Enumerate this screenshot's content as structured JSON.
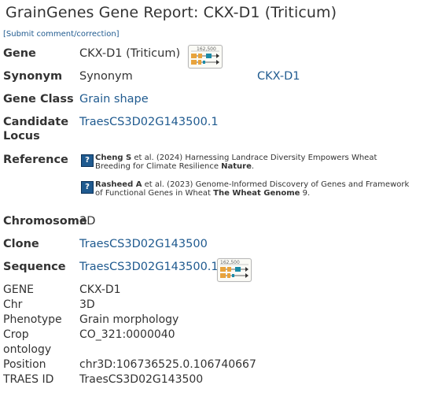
{
  "header": {
    "title": "GrainGenes Gene Report: CKX-D1 (Triticum)",
    "submit_link": "[Submit comment/correction]"
  },
  "gene": {
    "label": "Gene",
    "value": "CKX-D1 (Triticum)"
  },
  "synonym": {
    "label": "Synonym",
    "value_label": "Synonym",
    "value": "CKX-D1"
  },
  "gene_class": {
    "label": "Gene Class",
    "value": "Grain shape"
  },
  "candidate_locus": {
    "label_line1": "Candidate",
    "label_line2": "Locus",
    "value": "TraesCS3D02G143500.1"
  },
  "reference": {
    "label": "Reference",
    "items": [
      {
        "author": "Cheng S",
        "citation_mid": " et al. (2024) Harnessing Landrace Diversity Empowers Wheat Breeding for Climate Resilience ",
        "journal": "Nature",
        "tail": "."
      },
      {
        "author": "Rasheed A",
        "citation_mid": " et al. (2023) Genome-Informed Discovery of Genes and Framework of Functional Genes in Wheat ",
        "journal": "The Wheat Genome",
        "tail": " 9."
      }
    ],
    "icon": "question-icon",
    "icon_text": "?"
  },
  "chromosome": {
    "label": "Chromosome",
    "value": "3D"
  },
  "clone": {
    "label": "Clone",
    "value": "TraesCS3D02G143500"
  },
  "sequence": {
    "label": "Sequence",
    "value": "TraesCS3D02G143500.1"
  },
  "thumbnail": {
    "text": "162,500",
    "icon": "gene-model-thumbnail"
  },
  "details": [
    {
      "label": "GENE",
      "value": "CKX-D1"
    },
    {
      "label": "Chr",
      "value": "3D"
    },
    {
      "label": "Phenotype",
      "value": "Grain morphology"
    },
    {
      "label": "Crop",
      "label2": "ontology",
      "value": "CO_321:0000040"
    },
    {
      "label": "Position",
      "value": "chr3D:106736525.0.106740667"
    },
    {
      "label": "TRAES ID",
      "value": "TraesCS3D02G143500"
    }
  ],
  "colors": {
    "link": "#1f5a8f",
    "text": "#333333",
    "exon_orange": "#e8a33c",
    "exon_teal": "#1a8aa6"
  }
}
